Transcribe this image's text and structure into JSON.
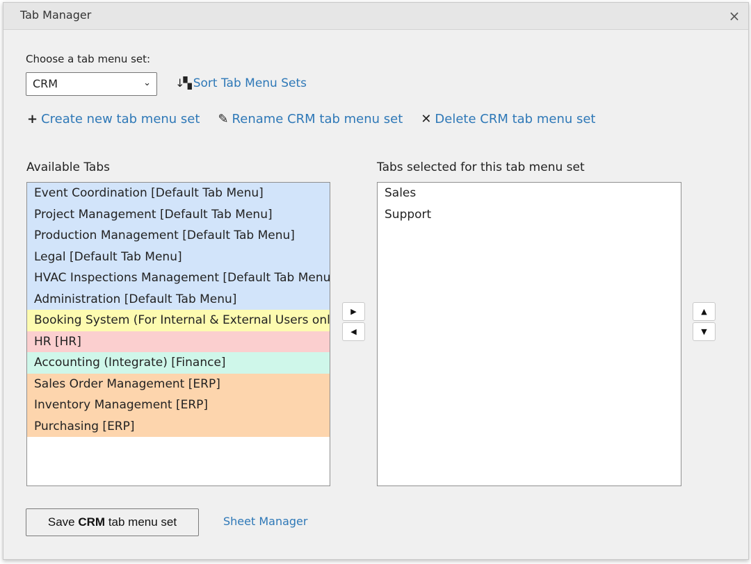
{
  "dialog": {
    "title": "Tab Manager",
    "close_glyph": "×"
  },
  "chooser": {
    "label": "Choose a tab menu set:",
    "selected": "CRM"
  },
  "sort": {
    "label": "Sort Tab Menu Sets",
    "icon": "sort-icon"
  },
  "actions": {
    "create": "Create new tab menu set",
    "rename": "Rename CRM tab menu set",
    "delete": "Delete CRM tab menu set"
  },
  "available": {
    "label": "Available Tabs",
    "items": [
      {
        "label": "Event Coordination [Default Tab Menu]",
        "color": "#d2e4fa"
      },
      {
        "label": "Project Management [Default Tab Menu]",
        "color": "#d2e4fa"
      },
      {
        "label": "Production Management [Default Tab Menu]",
        "color": "#d2e4fa"
      },
      {
        "label": "Legal [Default Tab Menu]",
        "color": "#d2e4fa"
      },
      {
        "label": "HVAC Inspections Management [Default Tab Menu]",
        "color": "#d2e4fa"
      },
      {
        "label": "Administration [Default Tab Menu]",
        "color": "#d2e4fa"
      },
      {
        "label": "Booking System (For Internal & External Users only)",
        "color": "#fdfbb0"
      },
      {
        "label": "HR [HR]",
        "color": "#fbcfcf"
      },
      {
        "label": "Accounting (Integrate) [Finance]",
        "color": "#cff7ea"
      },
      {
        "label": "Sales Order Management [ERP]",
        "color": "#fdd5ad"
      },
      {
        "label": "Inventory Management [ERP]",
        "color": "#fdd5ad"
      },
      {
        "label": "Purchasing [ERP]",
        "color": "#fdd5ad"
      }
    ]
  },
  "selected": {
    "label": "Tabs selected for this tab menu set",
    "items": [
      "Sales",
      "Support"
    ]
  },
  "transfer": {
    "right": "▶",
    "left": "◀"
  },
  "order": {
    "up": "▲",
    "down": "▼"
  },
  "footer": {
    "save_prefix": "Save ",
    "save_set": "CRM",
    "save_suffix": " tab menu set",
    "sheet_manager": "Sheet Manager"
  }
}
